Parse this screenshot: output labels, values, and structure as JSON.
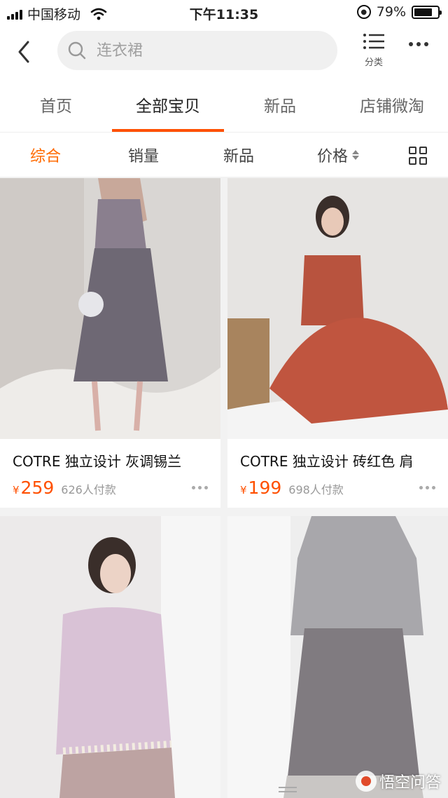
{
  "status_bar": {
    "carrier": "中国移动",
    "time": "下午11:35",
    "battery_percent": "79%",
    "battery_level": 0.79
  },
  "header": {
    "search_placeholder": "连衣裙",
    "category_label": "分类",
    "icons": [
      "back-icon",
      "search-icon",
      "list-icon",
      "more-icon"
    ]
  },
  "tabs": [
    {
      "label": "首页",
      "active": false
    },
    {
      "label": "全部宝贝",
      "active": true
    },
    {
      "label": "新品",
      "active": false
    },
    {
      "label": "店铺微淘",
      "active": false
    }
  ],
  "sort": {
    "overall": "综合",
    "sales": "销量",
    "new": "新品",
    "price": "价格"
  },
  "products": [
    {
      "title": "COTRE 独立设计 灰调锡兰",
      "currency": "¥",
      "price": "259",
      "sales": "626人付款"
    },
    {
      "title": "COTRE 独立设计 砖红色 肩",
      "currency": "¥",
      "price": "199",
      "sales": "698人付款"
    },
    {
      "title": "",
      "currency": "",
      "price": "",
      "sales": ""
    },
    {
      "title": "",
      "currency": "",
      "price": "",
      "sales": ""
    }
  ],
  "watermark": "悟空问答",
  "colors": {
    "accent": "#ff5000",
    "sort_active": "#ff6a00",
    "background": "#f2f2f2"
  }
}
